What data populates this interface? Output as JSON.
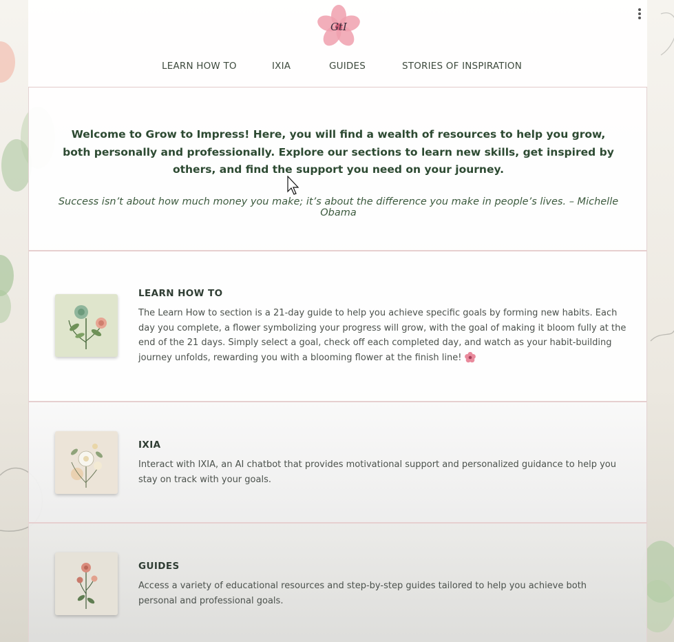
{
  "header": {
    "logo_text": "GtI",
    "nav": [
      {
        "label": "LEARN HOW TO"
      },
      {
        "label": "IXIA"
      },
      {
        "label": "GUIDES"
      },
      {
        "label": "STORIES OF INSPIRATION"
      }
    ],
    "menu_icon": "more-vertical-icon"
  },
  "welcome": {
    "intro": "Welcome to Grow to Impress! Here, you will find a wealth of resources to help you grow, both personally and professionally. Explore our sections to learn new skills, get inspired by others, and find the support you need on your journey.",
    "quote": "Success isn’t about how much money you make; it’s about the difference you make in people’s lives. – Michelle Obama"
  },
  "sections": [
    {
      "title": "LEARN HOW TO",
      "text": "The Learn How to section is a 21-day guide to help you achieve specific goals by forming new habits. Each day you complete, a flower symbolizing your progress will grow, with the goal of making it bloom fully at the end of the 21 days. Simply select a goal, check off each completed day, and watch as your habit-building journey unfolds, rewarding you with a blooming flower at the finish line!",
      "thumb_icon": "green-bouquet-icon",
      "emoji_icon": "pink-flower-icon"
    },
    {
      "title": "IXIA",
      "text": "Interact with IXIA, an AI chatbot that provides motivational support and personalized guidance to help you stay on track with your goals.",
      "thumb_icon": "white-bouquet-icon"
    },
    {
      "title": "GUIDES",
      "text": "Access a variety of educational resources and step-by-step guides tailored to help you achieve both personal and professional goals.",
      "thumb_icon": "rose-bouquet-icon"
    }
  ],
  "colors": {
    "heading": "#2d4a32",
    "accent_pink": "#e98a9c",
    "border": "#e2c9c9"
  }
}
